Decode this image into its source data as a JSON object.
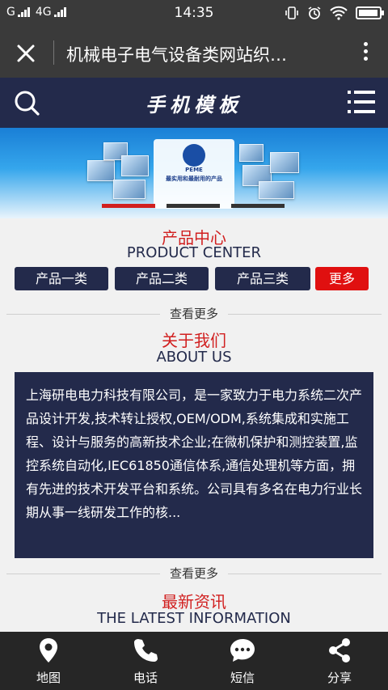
{
  "status_bar": {
    "carrier_left": "G",
    "network": "4G",
    "time": "14:35",
    "icons": [
      "vibrate-icon",
      "alarm-icon",
      "wifi-icon",
      "battery-icon"
    ],
    "battery_level": 0.95
  },
  "browser": {
    "title": "机械电子电气设备类网站织…"
  },
  "site_header": {
    "logo_text": "手机模板"
  },
  "banner": {
    "brand": "PEME",
    "tagline": "最实用和最耐用的产品",
    "slides": 3,
    "active_slide": 0
  },
  "products": {
    "title": "产品中心",
    "subtitle": "PRODUCT CENTER",
    "categories": [
      "产品一类",
      "产品二类",
      "产品三类",
      "更多"
    ]
  },
  "about": {
    "view_more": "查看更多",
    "title": "关于我们",
    "subtitle": "ABOUT US",
    "body": "上海研电电力科技有限公司，是一家致力于电力系统二次产品设计开发,技术转让授权,OEM/ODM,系统集成和实施工程、设计与服务的高新技术企业;在微机保护和测控装置,监控系统自动化,IEC61850通信体系,通信处理机等方面，拥有先进的技术开发平台和系统。公司具有多名在电力行业长期从事一线研发工作的核..."
  },
  "news": {
    "view_more": "查看更多",
    "title": "最新资讯",
    "subtitle": "THE LATEST INFORMATION"
  },
  "tabbar": {
    "items": [
      {
        "label": "地图",
        "icon": "map-pin-icon"
      },
      {
        "label": "电话",
        "icon": "phone-icon"
      },
      {
        "label": "短信",
        "icon": "message-icon"
      },
      {
        "label": "分享",
        "icon": "share-icon"
      }
    ]
  },
  "colors": {
    "navy": "#232a4b",
    "accent_red": "#d12020",
    "more_red": "#e01010"
  }
}
